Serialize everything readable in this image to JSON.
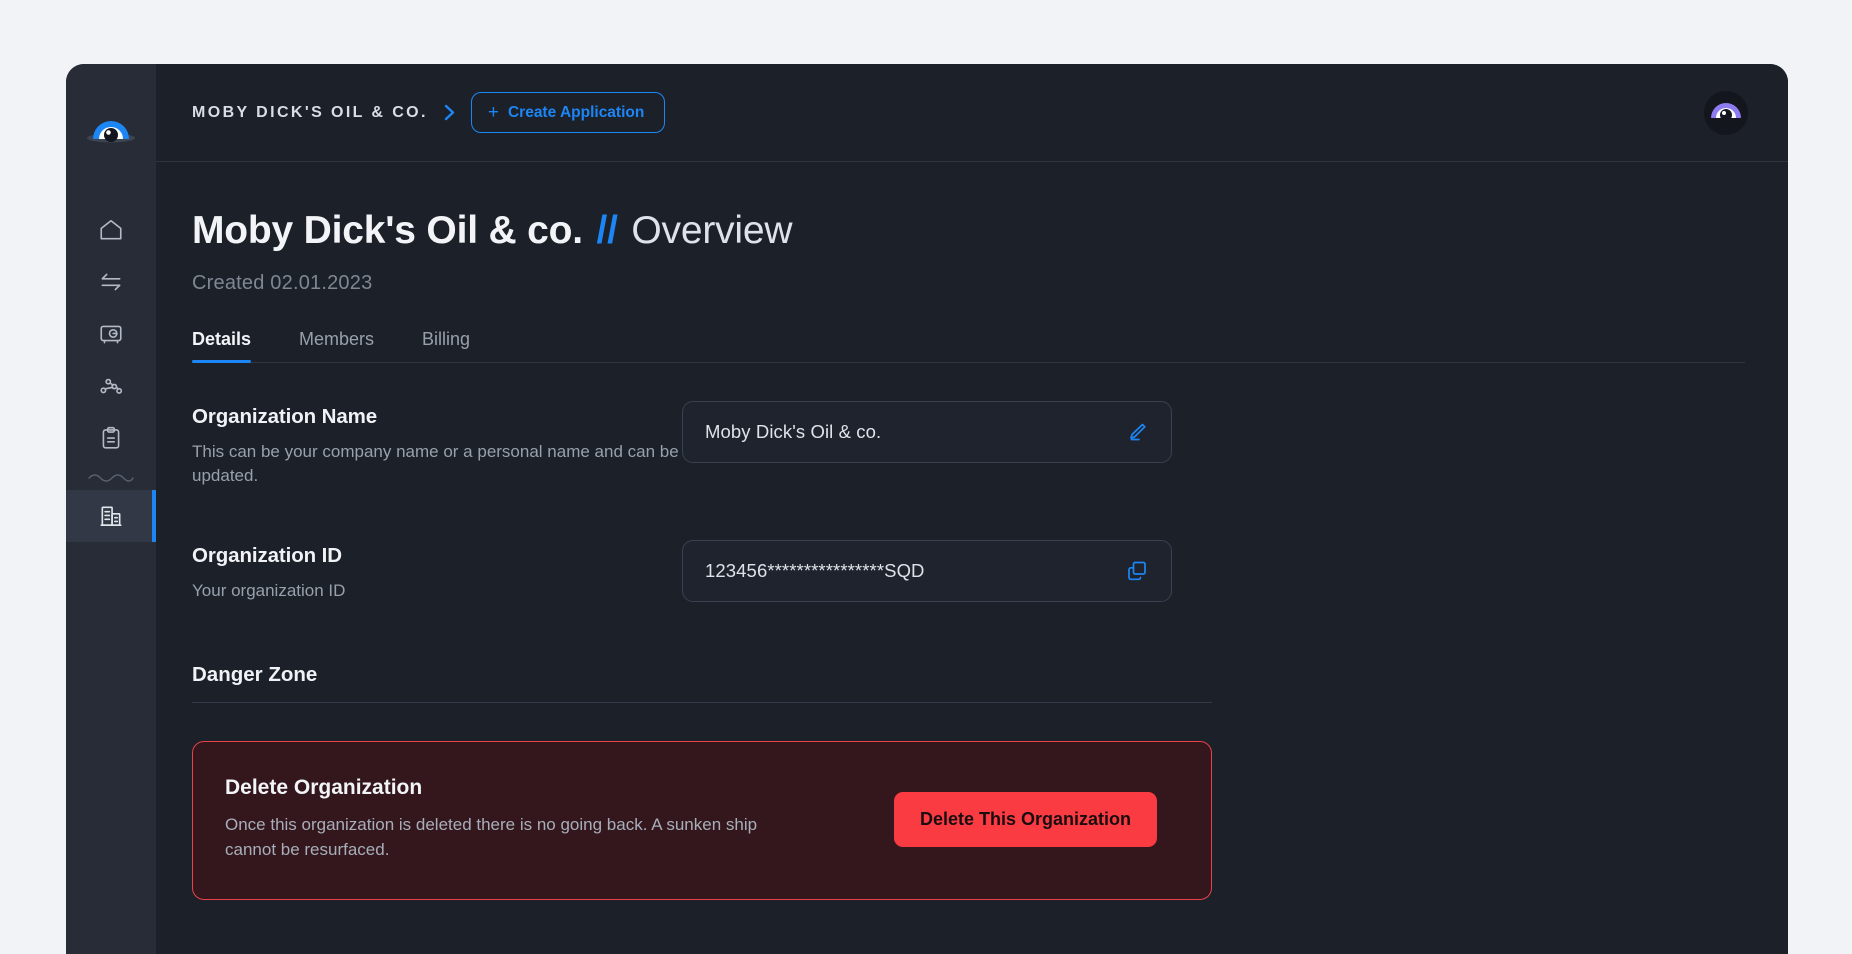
{
  "sidebar": {
    "logo_icon": "eye-logo-icon",
    "items": [
      {
        "icon": "home-icon",
        "name": "home",
        "active": false
      },
      {
        "icon": "transfer-arrows-icon",
        "name": "transfers",
        "active": false
      },
      {
        "icon": "vault-safe-icon",
        "name": "vault",
        "active": false
      },
      {
        "icon": "network-nodes-icon",
        "name": "network",
        "active": false
      },
      {
        "icon": "clipboard-icon",
        "name": "reports",
        "active": false
      },
      {
        "icon": "building-icon",
        "name": "organization",
        "active": true
      }
    ],
    "divider_icon": "wave-divider-icon"
  },
  "topbar": {
    "breadcrumb_org": "MOBY DICK'S OIL & CO.",
    "breadcrumb_chevron_icon": "chevron-right-icon",
    "create_plus": "+",
    "create_label": "Create Application",
    "avatar_icon": "eye-avatar-icon"
  },
  "header": {
    "org_name": "Moby Dick's Oil & co.",
    "separator": "//",
    "section": "Overview",
    "created": "Created 02.01.2023"
  },
  "tabs": [
    {
      "label": "Details",
      "active": true
    },
    {
      "label": "Members",
      "active": false
    },
    {
      "label": "Billing",
      "active": false
    }
  ],
  "fields": {
    "org_name": {
      "title": "Organization Name",
      "description": "This can be your company name or a personal name and can be updated.",
      "value": "Moby Dick's Oil & co.",
      "placeholder": "Organization name",
      "action_icon": "edit-pencil-icon"
    },
    "org_id": {
      "title": "Organization ID",
      "description": "Your organization ID",
      "value": "123456****************SQD",
      "placeholder": "Organization ID",
      "action_icon": "copy-icon"
    }
  },
  "danger": {
    "heading": "Danger Zone",
    "card_title": "Delete Organization",
    "card_description": "Once this organization is deleted there is no going back. A sunken ship cannot be resurfaced.",
    "button_label": "Delete This Organization"
  },
  "colors": {
    "accent_blue": "#1d86f5",
    "danger_red": "#fa3c42",
    "danger_border": "#e8434a",
    "danger_bg": "#33171d",
    "app_bg": "#1b2029",
    "sidebar_bg": "#272c37",
    "page_bg": "#f1f3f7"
  }
}
